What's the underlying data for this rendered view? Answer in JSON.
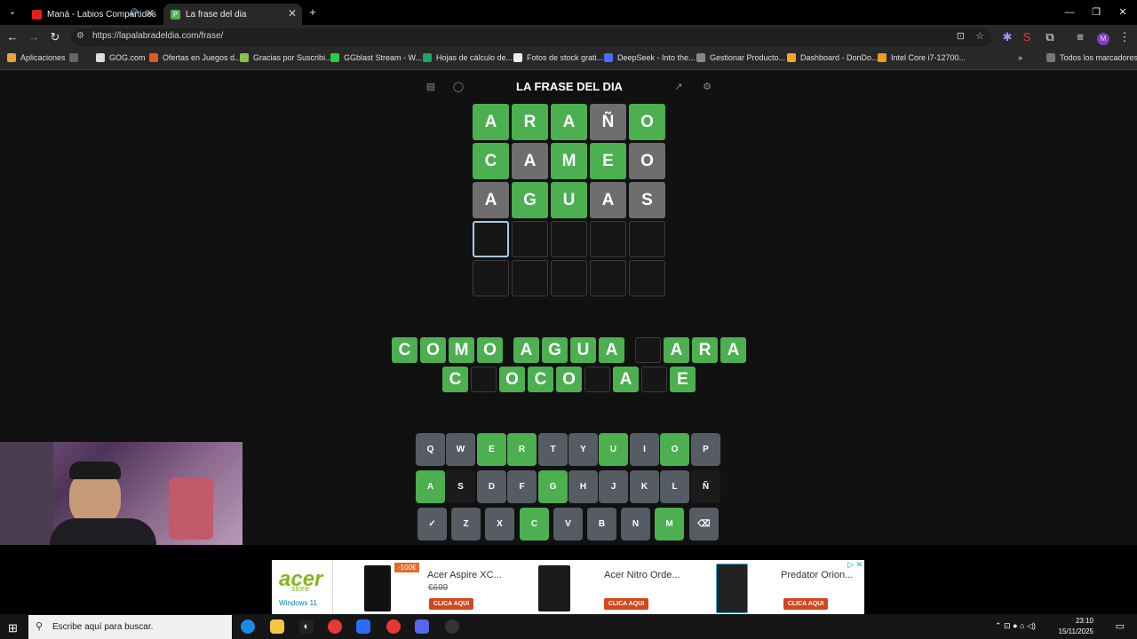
{
  "browser": {
    "tabs": [
      {
        "title": "Maná - Labios Compartidos",
        "active": false
      },
      {
        "title": "La frase del dia",
        "active": true
      }
    ],
    "url": "https://lapalabradeldia.com/frase/",
    "bookmarks": [
      "Aplicaciones",
      "GOG.com",
      "Ofertas en Juegos d...",
      "Gracias por Suscribi...",
      "GGblast Stream - W...",
      "Hojas de cálculo de...",
      "Fotos de stock grati...",
      "DeepSeek - Into the...",
      "Gestionar Producto...",
      "Dashboard - DonDo...",
      "Intel Core i7-12700...",
      "Todos los marcadores"
    ]
  },
  "game": {
    "title": "LA FRASE DEL DIA",
    "grid": [
      [
        {
          "l": "A",
          "s": "g"
        },
        {
          "l": "R",
          "s": "g"
        },
        {
          "l": "A",
          "s": "g"
        },
        {
          "l": "Ñ",
          "s": "x"
        },
        {
          "l": "O",
          "s": "g"
        }
      ],
      [
        {
          "l": "C",
          "s": "g"
        },
        {
          "l": "A",
          "s": "x"
        },
        {
          "l": "M",
          "s": "g"
        },
        {
          "l": "E",
          "s": "g"
        },
        {
          "l": "O",
          "s": "x"
        }
      ],
      [
        {
          "l": "A",
          "s": "x"
        },
        {
          "l": "G",
          "s": "g"
        },
        {
          "l": "U",
          "s": "g"
        },
        {
          "l": "A",
          "s": "x"
        },
        {
          "l": "S",
          "s": "x"
        }
      ],
      [
        {
          "l": "",
          "s": "sel"
        },
        {
          "l": "",
          "s": "e"
        },
        {
          "l": "",
          "s": "e"
        },
        {
          "l": "",
          "s": "e"
        },
        {
          "l": "",
          "s": "e"
        }
      ],
      [
        {
          "l": "",
          "s": "e"
        },
        {
          "l": "",
          "s": "e"
        },
        {
          "l": "",
          "s": "e"
        },
        {
          "l": "",
          "s": "e"
        },
        {
          "l": "",
          "s": "e"
        }
      ]
    ],
    "phrase": [
      [
        [
          "C",
          "O",
          "M",
          "O"
        ],
        [
          "A",
          "G",
          "U",
          "A"
        ],
        [
          "",
          "A",
          "R",
          "A"
        ]
      ],
      [
        [
          "C",
          "",
          "O",
          "C",
          "O",
          "",
          "A",
          "",
          "E"
        ]
      ]
    ],
    "keyboard": [
      [
        {
          "k": "Q",
          "s": "d"
        },
        {
          "k": "W",
          "s": "d"
        },
        {
          "k": "E",
          "s": "g"
        },
        {
          "k": "R",
          "s": "g"
        },
        {
          "k": "T",
          "s": "d"
        },
        {
          "k": "Y",
          "s": "d"
        },
        {
          "k": "U",
          "s": "g"
        },
        {
          "k": "I",
          "s": "d"
        },
        {
          "k": "O",
          "s": "g"
        },
        {
          "k": "P",
          "s": "d"
        }
      ],
      [
        {
          "k": "A",
          "s": "g"
        },
        {
          "k": "S",
          "s": "x"
        },
        {
          "k": "D",
          "s": "d"
        },
        {
          "k": "F",
          "s": "d"
        },
        {
          "k": "G",
          "s": "g"
        },
        {
          "k": "H",
          "s": "d"
        },
        {
          "k": "J",
          "s": "d"
        },
        {
          "k": "K",
          "s": "d"
        },
        {
          "k": "L",
          "s": "d"
        },
        {
          "k": "Ñ",
          "s": "x"
        }
      ],
      [
        {
          "k": "✓",
          "s": "d"
        },
        {
          "k": "Z",
          "s": "d"
        },
        {
          "k": "X",
          "s": "d"
        },
        {
          "k": "C",
          "s": "g"
        },
        {
          "k": "V",
          "s": "d"
        },
        {
          "k": "B",
          "s": "d"
        },
        {
          "k": "N",
          "s": "d"
        },
        {
          "k": "M",
          "s": "g"
        },
        {
          "k": "⌫",
          "s": "d"
        }
      ]
    ]
  },
  "ad": {
    "brand": "acer",
    "brand_sub": "store",
    "windows": "Windows 11",
    "discount": "-100€",
    "products": [
      {
        "title": "Acer Aspire XC...",
        "old_price": "€699",
        "cta": "CLICA AQUI"
      },
      {
        "title": "Acer Nitro Orde...",
        "cta": "CLICA AQUI"
      },
      {
        "title": "Predator Orion...",
        "cta": "CLICA AQUI"
      }
    ]
  },
  "taskbar": {
    "search_placeholder": "Escribe aquí para buscar.",
    "time": "23:10",
    "date": "15/11/2025"
  }
}
